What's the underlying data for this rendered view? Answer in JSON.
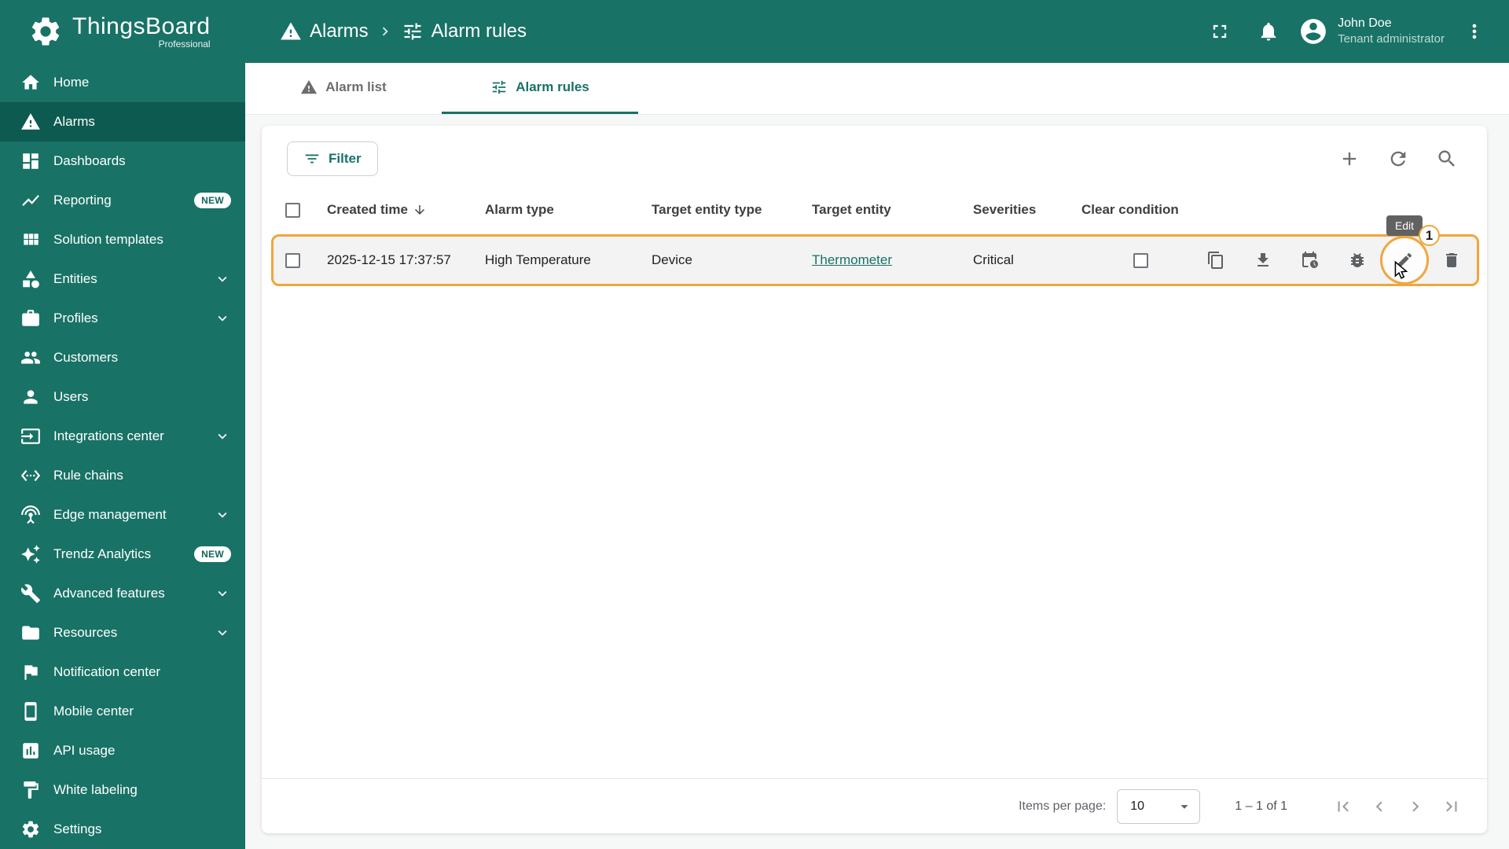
{
  "header": {
    "app_name": "ThingsBoard",
    "app_subtitle": "Professional",
    "breadcrumb": [
      {
        "label": "Alarms",
        "icon": "warning-icon"
      },
      {
        "label": "Alarm rules",
        "icon": "tune-icon"
      }
    ],
    "user": {
      "name": "John Doe",
      "role": "Tenant administrator"
    }
  },
  "sidebar": {
    "items": [
      {
        "label": "Home",
        "icon": "home-icon"
      },
      {
        "label": "Alarms",
        "icon": "warning-icon",
        "active": true
      },
      {
        "label": "Dashboards",
        "icon": "dashboards-icon"
      },
      {
        "label": "Reporting",
        "icon": "reporting-icon",
        "badge": "NEW"
      },
      {
        "label": "Solution templates",
        "icon": "templates-icon"
      },
      {
        "label": "Entities",
        "icon": "entities-icon",
        "expandable": true
      },
      {
        "label": "Profiles",
        "icon": "profiles-icon",
        "expandable": true
      },
      {
        "label": "Customers",
        "icon": "customers-icon"
      },
      {
        "label": "Users",
        "icon": "users-icon"
      },
      {
        "label": "Integrations center",
        "icon": "integrations-icon",
        "expandable": true
      },
      {
        "label": "Rule chains",
        "icon": "rule-chains-icon"
      },
      {
        "label": "Edge management",
        "icon": "edge-icon",
        "expandable": true
      },
      {
        "label": "Trendz Analytics",
        "icon": "trendz-icon",
        "badge": "NEW"
      },
      {
        "label": "Advanced features",
        "icon": "advanced-features-icon",
        "expandable": true
      },
      {
        "label": "Resources",
        "icon": "resources-icon",
        "expandable": true
      },
      {
        "label": "Notification center",
        "icon": "notification-center-icon"
      },
      {
        "label": "Mobile center",
        "icon": "mobile-center-icon"
      },
      {
        "label": "API usage",
        "icon": "api-usage-icon"
      },
      {
        "label": "White labeling",
        "icon": "white-labeling-icon"
      },
      {
        "label": "Settings",
        "icon": "settings-icon"
      }
    ]
  },
  "tabs": [
    {
      "label": "Alarm list",
      "active": false
    },
    {
      "label": "Alarm rules",
      "active": true
    }
  ],
  "toolbar": {
    "filter_label": "Filter"
  },
  "table": {
    "columns": [
      "Created time",
      "Alarm type",
      "Target entity type",
      "Target entity",
      "Severities",
      "Clear condition"
    ],
    "rows": [
      {
        "created_time": "2025-12-15 17:37:57",
        "alarm_type": "High Temperature",
        "target_entity_type": "Device",
        "target_entity": "Thermometer",
        "severities": "Critical",
        "clear_condition": false
      }
    ]
  },
  "annotation": {
    "step": "1",
    "tooltip": "Edit"
  },
  "pagination": {
    "items_per_page_label": "Items per page:",
    "items_per_page": "10",
    "range": "1 – 1 of 1"
  },
  "colors": {
    "primary": "#187266",
    "sidebar_active": "#0d5a50",
    "highlight": "#f0a63c",
    "tooltip_bg": "#616161"
  }
}
